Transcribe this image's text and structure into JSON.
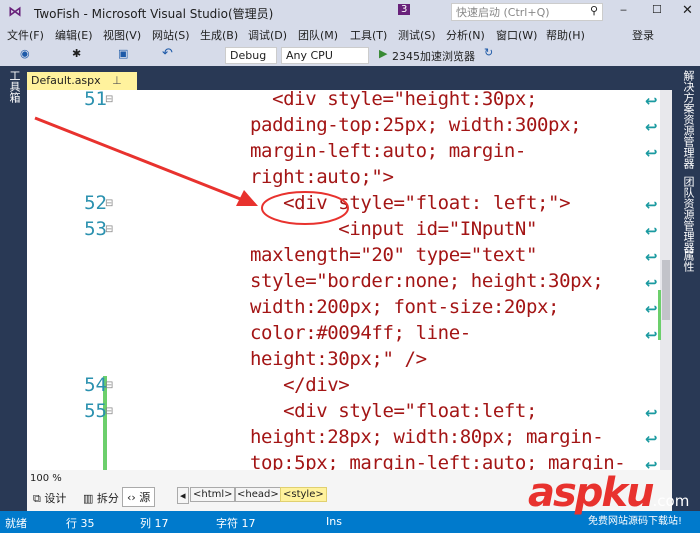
{
  "window": {
    "title": "TwoFish - Microsoft Visual Studio(管理员)",
    "notifications": "3",
    "quick_launch_placeholder": "快速启动 (Ctrl+Q)",
    "login": "登录"
  },
  "menu": [
    "文件(F)",
    "编辑(E)",
    "视图(V)",
    "网站(S)",
    "生成(B)",
    "调试(D)",
    "团队(M)",
    "工具(T)",
    "测试(S)",
    "分析(N)",
    "窗口(W)",
    "帮助(H)"
  ],
  "toolbar": {
    "config": "Debug",
    "platform": "Any CPU",
    "run_target": "2345加速浏览器"
  },
  "left_panel": "工具箱",
  "right_panels": [
    "解决方案资源管理器",
    "团队资源管理器",
    "属性"
  ],
  "tab": {
    "label": "Default.aspx",
    "pin": "ᵖ",
    "close": "×"
  },
  "code_lines": [
    {
      "num": "51",
      "text": "  <div style=\"height:30px;",
      "wrap": true
    },
    {
      "num": "",
      "text": "padding-top:25px; width:300px;",
      "wrap": true
    },
    {
      "num": "",
      "text": "margin-left:auto; margin-",
      "wrap": true
    },
    {
      "num": "",
      "text": "right:auto;\">",
      "wrap": false
    },
    {
      "num": "52",
      "text": "   <div style=\"float: left;\">",
      "wrap": true
    },
    {
      "num": "53",
      "text": "        <input id=\"INputN\"",
      "wrap": true
    },
    {
      "num": "",
      "text": "maxlength=\"20\" type=\"text\"",
      "wrap": true
    },
    {
      "num": "",
      "text": "style=\"border:none; height:30px;",
      "wrap": true
    },
    {
      "num": "",
      "text": "width:200px; font-size:20px;",
      "wrap": true
    },
    {
      "num": "",
      "text": "color:#0094ff; line-",
      "wrap": true
    },
    {
      "num": "",
      "text": "height:30px;\" />",
      "wrap": false
    },
    {
      "num": "54",
      "text": "   </div>",
      "wrap": false
    },
    {
      "num": "55",
      "text": "   <div style=\"float:left;",
      "wrap": true
    },
    {
      "num": "",
      "text": "height:28px; width:80px; margin-",
      "wrap": true
    },
    {
      "num": "",
      "text": "top:5px; margin-left:auto; margin-",
      "wrap": true
    }
  ],
  "bottom": {
    "zoom": "100 %",
    "design": "设计",
    "split": "拆分",
    "source": "源",
    "crumbs": [
      "<html>",
      "<head>",
      "<style>"
    ]
  },
  "status": {
    "ready": "就绪",
    "row": "行 35",
    "col": "列 17",
    "char": "字符 17",
    "mode": "Ins"
  },
  "watermark": {
    "brand": "aspku",
    "suffix": ".com",
    "slogan": "免费网站源码下载站!"
  },
  "colors": {
    "status": "#007acc",
    "doc_bg": "#293955",
    "tab": "#fff29d",
    "annotation": "#e8322e"
  }
}
